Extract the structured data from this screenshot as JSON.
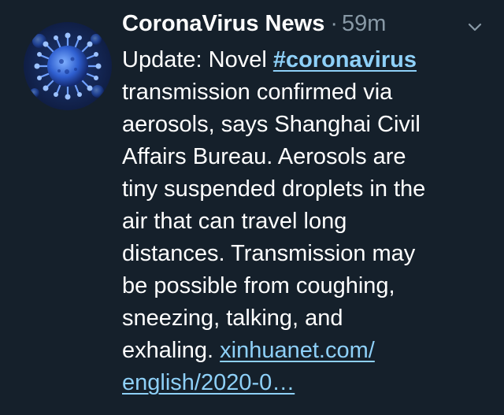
{
  "tweet": {
    "author": "CoronaVirus News",
    "separator": "·",
    "time": "59m",
    "text_lines": [
      [
        "Update: Novel ",
        "#coronavirus"
      ],
      "transmission confirmed via",
      "aerosols, says Shanghai Civil",
      "Affairs Bureau. Aerosols are",
      "tiny suspended droplets in the",
      "air that can travel long",
      "distances. Transmission may",
      "be possible from coughing,",
      "sneezing, talking, and",
      [
        "exhaling. ",
        "xinhuanet.com/"
      ],
      "english/2020-0…"
    ],
    "chevron_icon": "chevron-down-icon",
    "avatar_icon": "coronavirus-avatar",
    "colors": {
      "background": "#15202b",
      "text": "#ffffff",
      "muted": "#8899a6",
      "link": "#8ed0f8"
    }
  }
}
